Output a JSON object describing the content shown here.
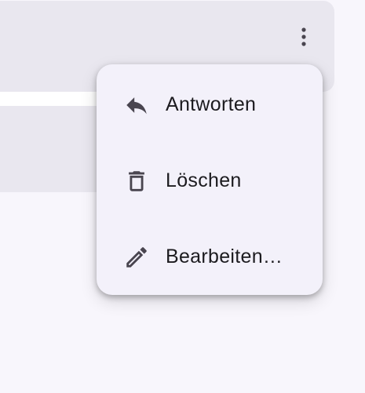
{
  "message": {
    "more_icon": "more-vert-icon"
  },
  "menu": {
    "items": [
      {
        "label": "Antworten",
        "icon": "reply-icon"
      },
      {
        "label": "Löschen",
        "icon": "delete-icon"
      },
      {
        "label": "Bearbeiten…",
        "icon": "edit-icon"
      }
    ]
  },
  "colors": {
    "background": "#f8f6fc",
    "card": "#e9e7ef",
    "menu_surface": "#f3f1fa",
    "icon": "#49454f",
    "text": "#1c1b1f"
  }
}
